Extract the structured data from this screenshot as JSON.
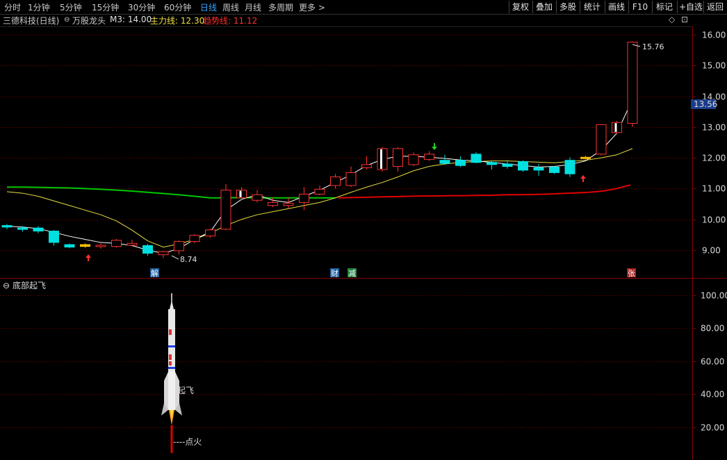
{
  "toolbar": {
    "timeframes": [
      "分时",
      "1分钟",
      "5分钟",
      "15分钟",
      "30分钟",
      "60分钟",
      "日线",
      "周线",
      "月线",
      "多周期",
      "更多 >"
    ],
    "active": "日线",
    "right_buttons": [
      "复权",
      "叠加",
      "多股",
      "统计",
      "画线",
      "F10",
      "标记",
      "+自选",
      "返回"
    ]
  },
  "info": {
    "stock": "三德科技(日线)",
    "indicator": "万股龙头",
    "m3": "M3: 14.00",
    "main_line": "主力线: 12.30",
    "trend_line": "趋势线: 11.12",
    "diamond": "◇",
    "scroll": "⊡"
  },
  "sub": {
    "title": "底部起飞",
    "liftoff": "起飞",
    "ignite": "----点火"
  },
  "markers": {
    "jie": "解",
    "cai": "财",
    "jian": "减",
    "zhang": "张"
  },
  "price_label": "13.56",
  "colors": {
    "up": "#ff3232",
    "down": "#00e0e0",
    "ma_white": "#ffffff",
    "ma_yellow": "#e8e040",
    "trend_green": "#00c800",
    "trend_red": "#e00000",
    "active_tab": "#36a3ff"
  },
  "chart_data": {
    "type": "candlestick",
    "ylim": [
      8.4,
      16.4
    ],
    "y_ticks": [
      9.0,
      10.0,
      11.0,
      12.0,
      13.0,
      14.0,
      15.0,
      16.0
    ],
    "high_label": "15.76",
    "low_label": "8.74",
    "current_price": 13.56,
    "candles": [
      [
        9.75,
        9.8,
        9.85,
        9.68,
        "d"
      ],
      [
        9.72,
        9.7,
        9.78,
        9.6,
        "d"
      ],
      [
        9.72,
        9.62,
        9.78,
        9.55,
        "d"
      ],
      [
        9.62,
        9.25,
        9.65,
        9.15,
        "d"
      ],
      [
        9.18,
        9.1,
        9.22,
        9.06,
        "d"
      ],
      [
        9.12,
        9.18,
        9.22,
        9.08,
        "y"
      ],
      [
        9.12,
        9.16,
        9.22,
        9.05,
        "u"
      ],
      [
        9.12,
        9.32,
        9.36,
        9.08,
        "u"
      ],
      [
        9.16,
        9.22,
        9.34,
        9.12,
        "u"
      ],
      [
        9.15,
        8.9,
        9.2,
        8.82,
        "d"
      ],
      [
        8.85,
        8.95,
        8.98,
        8.74,
        "u"
      ],
      [
        8.98,
        9.28,
        9.32,
        8.86,
        "u"
      ],
      [
        9.28,
        9.48,
        9.52,
        9.22,
        "u"
      ],
      [
        9.46,
        9.66,
        9.7,
        9.4,
        "u"
      ],
      [
        9.68,
        10.95,
        11.15,
        9.65,
        "u"
      ],
      [
        10.95,
        10.7,
        11.05,
        10.62,
        "w"
      ],
      [
        10.62,
        10.8,
        10.96,
        10.55,
        "u"
      ],
      [
        10.55,
        10.45,
        10.72,
        10.4,
        "u"
      ],
      [
        10.52,
        10.45,
        10.72,
        10.35,
        "u"
      ],
      [
        10.55,
        10.82,
        11.05,
        10.3,
        "u"
      ],
      [
        10.82,
        10.98,
        11.1,
        10.78,
        "u"
      ],
      [
        11.1,
        11.38,
        11.48,
        11.0,
        "u"
      ],
      [
        11.1,
        11.52,
        11.72,
        11.05,
        "u"
      ],
      [
        11.68,
        11.78,
        12.05,
        11.62,
        "u"
      ],
      [
        11.62,
        12.3,
        12.35,
        11.55,
        "w"
      ],
      [
        11.72,
        12.3,
        12.35,
        11.55,
        "u"
      ],
      [
        11.78,
        12.1,
        12.18,
        11.72,
        "u"
      ],
      [
        11.95,
        12.12,
        12.22,
        11.9,
        "u"
      ],
      [
        11.92,
        11.82,
        12.1,
        11.78,
        "d"
      ],
      [
        11.92,
        11.75,
        12.05,
        11.7,
        "d"
      ],
      [
        12.12,
        11.85,
        12.18,
        11.82,
        "d"
      ],
      [
        11.85,
        11.78,
        11.9,
        11.62,
        "d"
      ],
      [
        11.8,
        11.72,
        11.92,
        11.65,
        "d"
      ],
      [
        11.88,
        11.6,
        11.92,
        11.55,
        "d"
      ],
      [
        11.68,
        11.6,
        11.8,
        11.42,
        "d"
      ],
      [
        11.7,
        11.52,
        11.72,
        11.48,
        "d"
      ],
      [
        11.48,
        11.92,
        12.02,
        11.38,
        "d"
      ],
      [
        12.0,
        12.02,
        12.06,
        11.95,
        "y"
      ],
      [
        12.12,
        13.08,
        13.1,
        12.08,
        "u"
      ],
      [
        12.82,
        13.15,
        13.2,
        12.78,
        "w"
      ],
      [
        13.12,
        15.76,
        15.78,
        13.0,
        "u"
      ]
    ],
    "ma_white": [
      9.78,
      9.75,
      9.7,
      9.58,
      9.45,
      9.35,
      9.25,
      9.22,
      9.15,
      9.0,
      8.9,
      9.05,
      9.35,
      9.6,
      10.3,
      10.65,
      10.8,
      10.62,
      10.55,
      10.75,
      10.95,
      11.2,
      11.45,
      11.75,
      11.95,
      12.05,
      12.05,
      12.02,
      11.98,
      11.93,
      11.9,
      11.85,
      11.8,
      11.75,
      11.7,
      11.72,
      11.78,
      11.9,
      12.25,
      12.8,
      13.9
    ],
    "ma_yellow": [
      10.9,
      10.85,
      10.75,
      10.6,
      10.45,
      10.3,
      10.15,
      9.95,
      9.65,
      9.3,
      9.1,
      9.2,
      9.35,
      9.55,
      9.8,
      10.0,
      10.15,
      10.25,
      10.35,
      10.45,
      10.55,
      10.7,
      10.88,
      11.05,
      11.2,
      11.38,
      11.58,
      11.72,
      11.8,
      11.85,
      11.88,
      11.9,
      11.9,
      11.88,
      11.86,
      11.84,
      11.88,
      11.92,
      12.0,
      12.1,
      12.3
    ],
    "trend_green": [
      11.05,
      11.05,
      11.04,
      11.03,
      11.02,
      11.0,
      10.98,
      10.95,
      10.92,
      10.88,
      10.84,
      10.8,
      10.75,
      10.7,
      10.7,
      10.71,
      10.7,
      10.7,
      10.7,
      10.7,
      10.7,
      10.7
    ],
    "trend_red": [
      10.7,
      10.71,
      10.72,
      10.73,
      10.74,
      10.75,
      10.76,
      10.76,
      10.77,
      10.77,
      10.78,
      10.78,
      10.8,
      10.8,
      10.81,
      10.82,
      10.84,
      10.86,
      10.88,
      10.92,
      11.0,
      11.12
    ],
    "sub_ylim": [
      0,
      110
    ],
    "sub_ticks": [
      20.0,
      40.0,
      60.0,
      80.0,
      100.0
    ]
  }
}
